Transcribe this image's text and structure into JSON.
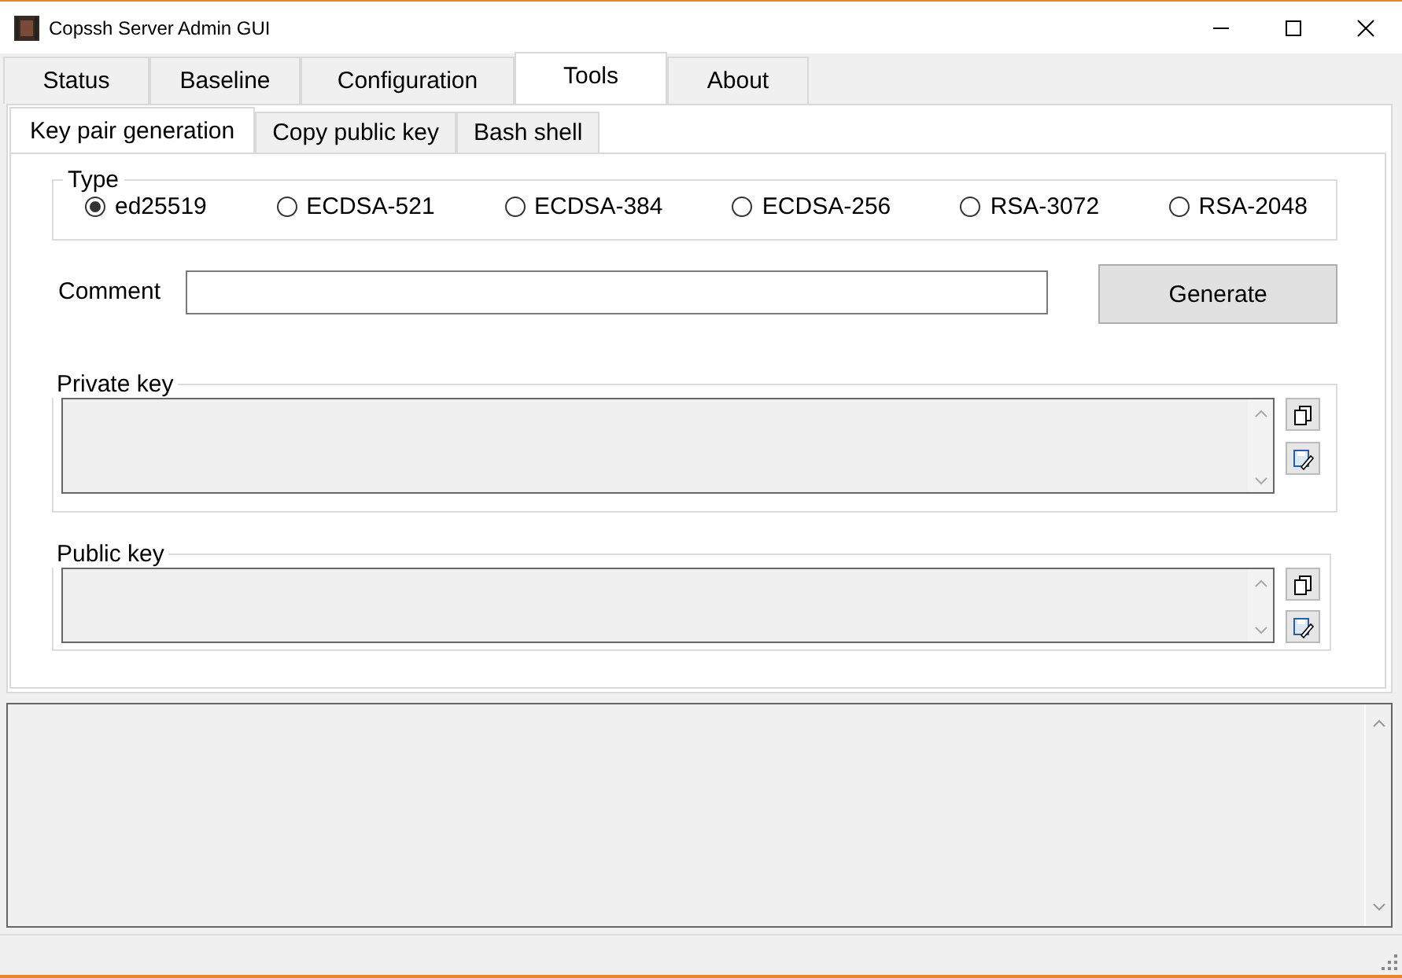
{
  "window": {
    "title": "Copssh Server Admin GUI"
  },
  "tabs": [
    {
      "label": "Status",
      "selected": false
    },
    {
      "label": "Baseline",
      "selected": false
    },
    {
      "label": "Configuration",
      "selected": false
    },
    {
      "label": "Tools",
      "selected": true
    },
    {
      "label": "About",
      "selected": false
    }
  ],
  "subtabs": [
    {
      "label": "Key pair generation",
      "selected": true
    },
    {
      "label": "Copy public key",
      "selected": false
    },
    {
      "label": "Bash shell",
      "selected": false
    }
  ],
  "type_group": {
    "title": "Type",
    "options": [
      {
        "label": "ed25519",
        "selected": true
      },
      {
        "label": "ECDSA-521",
        "selected": false
      },
      {
        "label": "ECDSA-384",
        "selected": false
      },
      {
        "label": "ECDSA-256",
        "selected": false
      },
      {
        "label": "RSA-3072",
        "selected": false
      },
      {
        "label": "RSA-2048",
        "selected": false
      }
    ]
  },
  "comment": {
    "label": "Comment"
  },
  "generate_button": "Generate",
  "key_groups": [
    {
      "title": "Private key"
    },
    {
      "title": "Public key"
    }
  ]
}
